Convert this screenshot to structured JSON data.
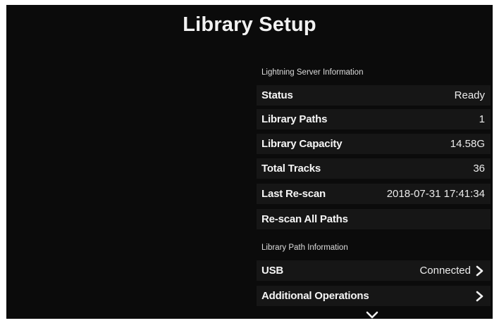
{
  "title": "Library Setup",
  "server_section": {
    "header": "Lightning Server Information",
    "rows": [
      {
        "label": "Status",
        "value": "Ready"
      },
      {
        "label": "Library Paths",
        "value": "1"
      },
      {
        "label": "Library Capacity",
        "value": "14.58G"
      },
      {
        "label": "Total Tracks",
        "value": "36"
      },
      {
        "label": "Last Re-scan",
        "value": "2018-07-31 17:41:34"
      },
      {
        "label": "Re-scan All Paths",
        "value": ""
      }
    ]
  },
  "path_section": {
    "header": "Library Path Information",
    "rows": [
      {
        "label": "USB",
        "value": "Connected",
        "icon": "chevron-right-icon"
      },
      {
        "label": "Additional Operations",
        "value": "",
        "icon": "chevron-right-icon"
      }
    ]
  },
  "scroll_icon": "chevron-down-icon",
  "colors": {
    "background": "#0b0b0b",
    "row_background": "#161616",
    "text": "#f5f5f5"
  }
}
